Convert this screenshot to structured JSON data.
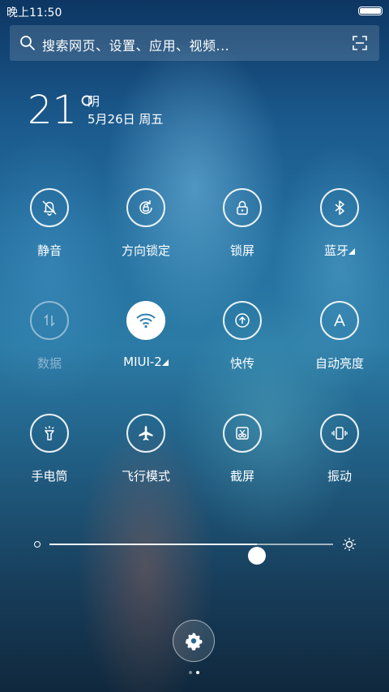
{
  "status_bar": {
    "time": "晚上11:50",
    "battery_level": 1.0
  },
  "search": {
    "placeholder": "搜索网页、设置、应用、视频..."
  },
  "weather": {
    "temperature": "21°",
    "condition": "阴",
    "date": "5月26日 周五"
  },
  "toggles": [
    {
      "id": "mute",
      "label": "静音",
      "icon": "bell-off-icon",
      "active": false,
      "enabled": true
    },
    {
      "id": "rotation-lock",
      "label": "方向锁定",
      "icon": "rotation-lock-icon",
      "active": false,
      "enabled": true
    },
    {
      "id": "lock-screen",
      "label": "锁屏",
      "icon": "lock-icon",
      "active": false,
      "enabled": true
    },
    {
      "id": "bluetooth",
      "label": "蓝牙",
      "icon": "bluetooth-icon",
      "active": false,
      "enabled": true,
      "has_menu": true
    },
    {
      "id": "data",
      "label": "数据",
      "icon": "mobile-data-icon",
      "active": false,
      "enabled": false
    },
    {
      "id": "wifi",
      "label": "MIUI-2",
      "icon": "wifi-icon",
      "active": true,
      "enabled": true,
      "has_menu": true
    },
    {
      "id": "quick-transfer",
      "label": "快传",
      "icon": "quick-transfer-icon",
      "active": false,
      "enabled": true
    },
    {
      "id": "auto-brightness",
      "label": "自动亮度",
      "icon": "auto-brightness-icon",
      "active": false,
      "enabled": true
    },
    {
      "id": "flashlight",
      "label": "手电筒",
      "icon": "flashlight-icon",
      "active": false,
      "enabled": true
    },
    {
      "id": "airplane-mode",
      "label": "飞行模式",
      "icon": "airplane-icon",
      "active": false,
      "enabled": true
    },
    {
      "id": "screenshot",
      "label": "截屏",
      "icon": "screenshot-icon",
      "active": false,
      "enabled": true
    },
    {
      "id": "vibrate",
      "label": "振动",
      "icon": "vibrate-icon",
      "active": false,
      "enabled": true
    }
  ],
  "brightness": {
    "level": 0.73
  },
  "pager": {
    "page_count": 2,
    "current_page": 2
  },
  "colors": {
    "active_toggle_bg": "#ffffff",
    "active_toggle_icon": "#2f7fb0"
  }
}
